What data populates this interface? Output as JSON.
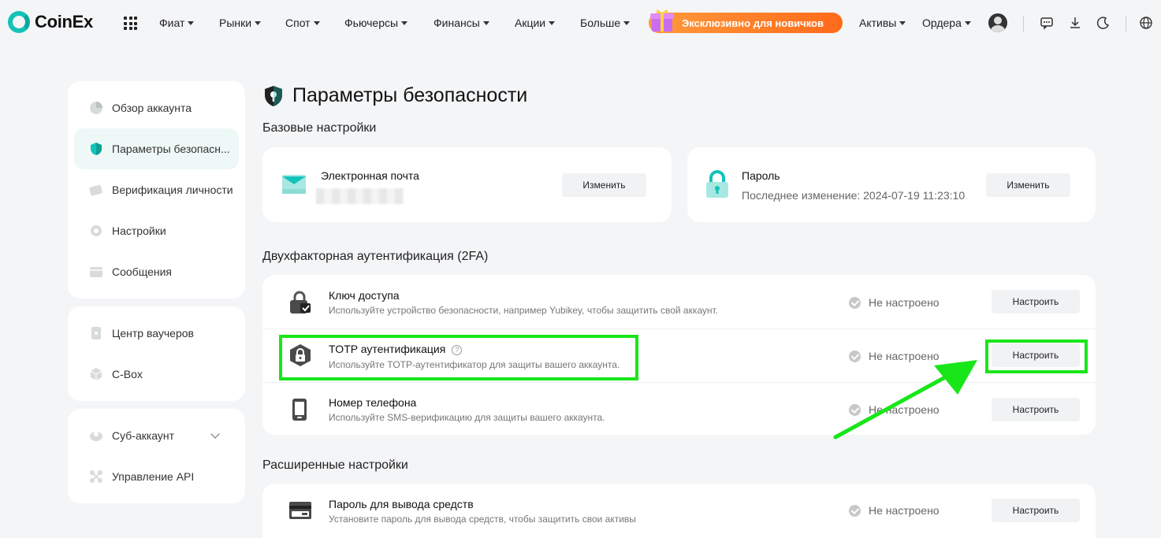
{
  "brand": {
    "name": "CoinEx"
  },
  "nav": {
    "items": [
      {
        "label": "Фиат"
      },
      {
        "label": "Рынки"
      },
      {
        "label": "Спот"
      },
      {
        "label": "Фьючерсы"
      },
      {
        "label": "Финансы"
      },
      {
        "label": "Акции"
      },
      {
        "label": "Больше"
      }
    ],
    "promo": "Эксклюзивно для новичков",
    "right": [
      {
        "label": "Активы"
      },
      {
        "label": "Ордера"
      }
    ]
  },
  "sidebar": {
    "group1": [
      {
        "label": "Обзор аккаунта",
        "icon": "pie-chart-icon"
      },
      {
        "label": "Параметры безопасн...",
        "icon": "shield-icon",
        "active": true
      },
      {
        "label": "Верификация личности",
        "icon": "id-card-icon"
      },
      {
        "label": "Настройки",
        "icon": "gear-icon"
      },
      {
        "label": "Сообщения",
        "icon": "message-icon"
      }
    ],
    "group2": [
      {
        "label": "Центр ваучеров",
        "icon": "voucher-icon"
      },
      {
        "label": "C-Box",
        "icon": "box-icon"
      }
    ],
    "group3": [
      {
        "label": "Суб-аккаунт",
        "icon": "sub-account-icon"
      },
      {
        "label": "Управление API",
        "icon": "api-icon"
      }
    ]
  },
  "page": {
    "title": "Параметры безопасности",
    "basic_title": "Базовые настройки",
    "email": {
      "title": "Электронная почта",
      "button": "Изменить"
    },
    "password": {
      "title": "Пароль",
      "sub": "Последнее изменение: 2024-07-19 11:23:10",
      "button": "Изменить"
    },
    "twofa_title": "Двухфакторная аутентификация (2FA)",
    "twofa_rows": [
      {
        "title": "Ключ доступа",
        "desc": "Используйте устройство безопасности, например Yubikey, чтобы защитить свой аккаунт.",
        "status": "Не настроено",
        "button": "Настроить"
      },
      {
        "title": "TOTP аутентификация",
        "help": "?",
        "desc": "Используйте TOTP-аутентификатор для защиты вашего аккаунта.",
        "status": "Не настроено",
        "button": "Настроить"
      },
      {
        "title": "Номер телефона",
        "desc": "Используйте SMS-верификацию для защиты вашего аккаунта.",
        "status": "Не настроено",
        "button": "Настроить"
      }
    ],
    "advanced_title": "Расширенные настройки",
    "advanced_rows": [
      {
        "title": "Пароль для вывода средств",
        "desc": "Установите пароль для вывода средств, чтобы защитить свои активы",
        "status": "Не настроено",
        "button": "Настроить"
      }
    ]
  },
  "colors": {
    "accent": "#13c2b8",
    "highlight": "#19e619",
    "promo": "#ff7a20"
  }
}
